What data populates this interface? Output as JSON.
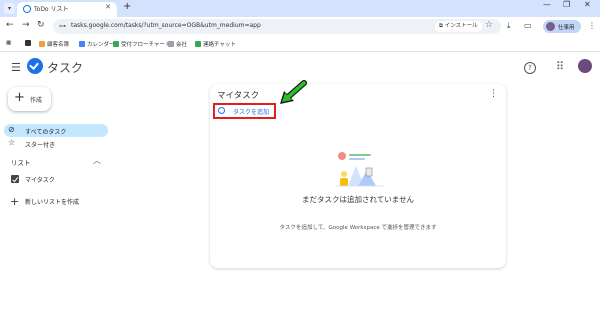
{
  "browser": {
    "tab_title": "ToDo リスト",
    "url": "tasks.google.com/tasks/?utm_source=OGB&utm_medium=app",
    "install_label": "インストール",
    "profile_label": "仕事用"
  },
  "bookmarks": [
    {
      "label": "顧客名簿",
      "color": "#e8a33d"
    },
    {
      "label": "カレンダー",
      "color": "#4285f4"
    },
    {
      "label": "受付フローチャート",
      "color": "#34a853"
    },
    {
      "label": "会社",
      "color": "#9aa0a6"
    },
    {
      "label": "連絡チャット",
      "color": "#34a853"
    }
  ],
  "app": {
    "title": "タスク"
  },
  "sidebar": {
    "create_label": "作成",
    "items": [
      {
        "label": "すべてのタスク",
        "icon": "check-circle-icon",
        "active": true
      },
      {
        "label": "スター付き",
        "icon": "star-icon",
        "active": false
      }
    ],
    "lists_heading": "リスト",
    "lists": [
      {
        "label": "マイタスク",
        "checked": true
      }
    ],
    "new_list_label": "新しいリストを作成"
  },
  "main": {
    "list_title": "マイタスク",
    "add_task_label": "タスクを追加",
    "empty_title": "まだタスクは追加されていません",
    "empty_description": "タスクを追加して、Google Workspace で進捗を管理できます"
  },
  "colors": {
    "accent": "#1a73e8",
    "highlight_box": "#e0201a",
    "annotation_arrow": "#2bbf2b",
    "active_nav": "#c2e7ff"
  }
}
